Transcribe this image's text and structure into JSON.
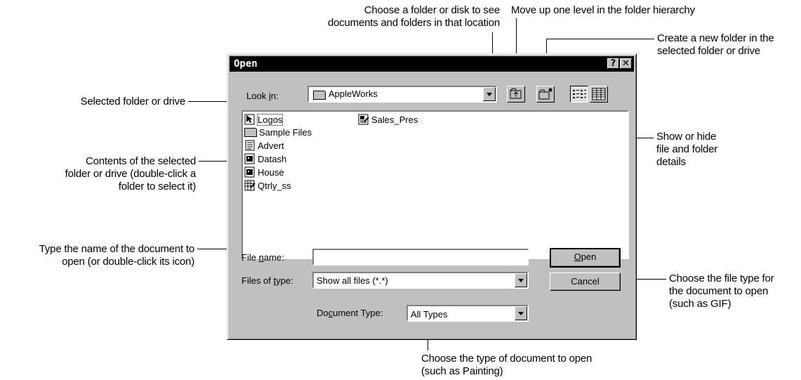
{
  "dialog": {
    "title": "Open",
    "help_glyph": "?",
    "close_glyph": "✕",
    "look_in_label": "Look in:",
    "look_in_value": "AppleWorks",
    "file_name_label": "File name:",
    "file_name_value": "",
    "files_of_type_label": "Files of type:",
    "files_of_type_value": "Show all files (*.*)",
    "document_type_label": "Document Type:",
    "document_type_value": "All Types",
    "open_button": "Open",
    "cancel_button": "Cancel",
    "files": [
      {
        "name": "Logos",
        "icon": "cursor-file-icon"
      },
      {
        "name": "Sample Files",
        "icon": "folder-icon"
      },
      {
        "name": "Advert",
        "icon": "text-doc-icon"
      },
      {
        "name": "Datash",
        "icon": "database-icon"
      },
      {
        "name": "House",
        "icon": "database-icon"
      },
      {
        "name": "Qtrly_ss",
        "icon": "spreadsheet-icon"
      },
      {
        "name": "Sales_Pres",
        "icon": "presentation-icon"
      }
    ]
  },
  "callouts": {
    "look_in": [
      "Choose a folder or disk to see",
      "documents and folders in that location"
    ],
    "up_level": "Move up one level in the folder hierarchy",
    "new_folder": [
      "Create a new folder in the",
      "selected folder or drive"
    ],
    "selected_folder": "Selected folder or drive",
    "contents": [
      "Contents of the selected",
      "folder or drive (double-click a",
      "folder to select it)"
    ],
    "details": [
      "Show or hide",
      "file and folder",
      "details"
    ],
    "type_name": [
      "Type the name of the document to",
      "open (or double-click its icon)"
    ],
    "file_type": [
      "Choose the file type for",
      "the document to open",
      "(such as GIF)"
    ],
    "doc_type": [
      "Choose the type of document to open",
      "(such as Painting)"
    ]
  }
}
